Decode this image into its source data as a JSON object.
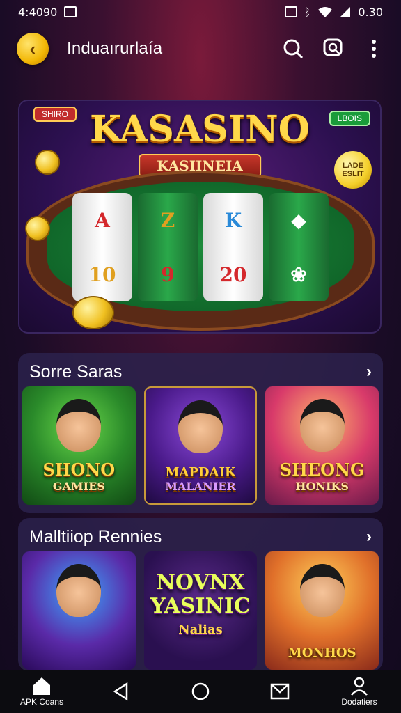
{
  "status_bar": {
    "time": "4:4090",
    "battery": "0.30"
  },
  "app_bar": {
    "title": "Induaırurlaía",
    "back_icon": "chevron-left-icon",
    "search_icon": "search-icon",
    "chat_search_icon": "chat-search-icon",
    "more_icon": "more-vertical-icon"
  },
  "hero": {
    "title": "KASASINO",
    "subtitle": "KASIINEIA",
    "tag_left": "SHIRO",
    "tag_right": "LBOIS",
    "badge": "LADE ESLIT",
    "reels": [
      [
        "A",
        "10"
      ],
      [
        "Z",
        "9"
      ],
      [
        "K",
        "20"
      ],
      [
        "",
        ""
      ]
    ]
  },
  "section1": {
    "title": "Sorre Saras",
    "cards": [
      {
        "line1": "SHONO",
        "line2": "GAMIES"
      },
      {
        "line1": "MAPDAIK",
        "line2": "MALANIER"
      },
      {
        "line1": "SHEONG",
        "line2": "HONIKS"
      }
    ]
  },
  "section2": {
    "title": "Malltiiop Rennies",
    "cards": [
      {
        "line1": "",
        "line2": ""
      },
      {
        "line1": "NOVNX",
        "line2": "YASINIC",
        "line3": "Nalias"
      },
      {
        "line1": "MONHOS",
        "line2": ""
      }
    ]
  },
  "nav": {
    "home_label": "APK Coans",
    "profile_label": "Dodatiers"
  },
  "colors": {
    "accent_gold": "#f2b705",
    "section_bg": "#2c224c",
    "nav_bg": "#0c0c10"
  }
}
